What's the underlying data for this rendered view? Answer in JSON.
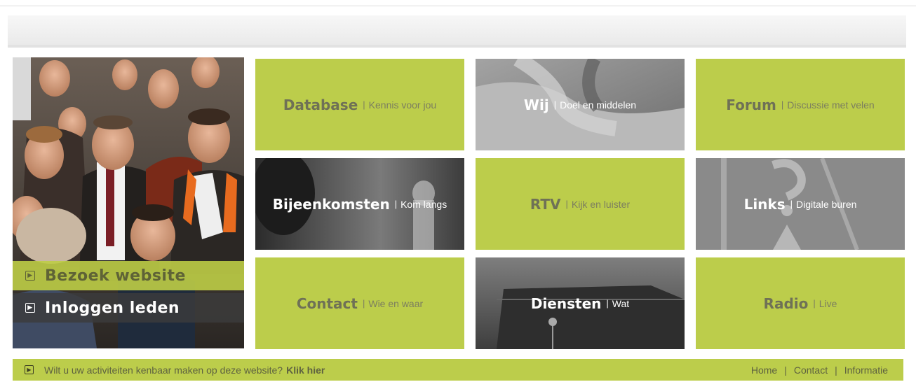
{
  "promo": {
    "visit_label": "Bezoek website",
    "login_label": "Inloggen leden",
    "arrow_icon": "arrow-right-box-icon"
  },
  "tiles": [
    {
      "title": "Database",
      "subtitle": "Kennis voor jou",
      "style": "green"
    },
    {
      "title": "Wij",
      "subtitle": "Doel en middelen",
      "style": "photo"
    },
    {
      "title": "Forum",
      "subtitle": "Discussie met velen",
      "style": "green"
    },
    {
      "title": "Bijeenkomsten",
      "subtitle": "Kom langs",
      "style": "photo"
    },
    {
      "title": "RTV",
      "subtitle": "Kijk en luister",
      "style": "green"
    },
    {
      "title": "Links",
      "subtitle": "Digitale buren",
      "style": "photo"
    },
    {
      "title": "Contact",
      "subtitle": "Wie en waar",
      "style": "green"
    },
    {
      "title": "Diensten",
      "subtitle": "Wat",
      "style": "photo"
    },
    {
      "title": "Radio",
      "subtitle": "Live",
      "style": "green"
    }
  ],
  "footer": {
    "message": "Wilt u uw activiteiten kenbaar maken op deze website?",
    "cta": "Klik hier",
    "links": [
      "Home",
      "Contact",
      "Informatie"
    ]
  },
  "colors": {
    "accent_green": "#bccd4b",
    "text_olive": "#6f7156",
    "dark_overlay": "#3c3c3c"
  }
}
